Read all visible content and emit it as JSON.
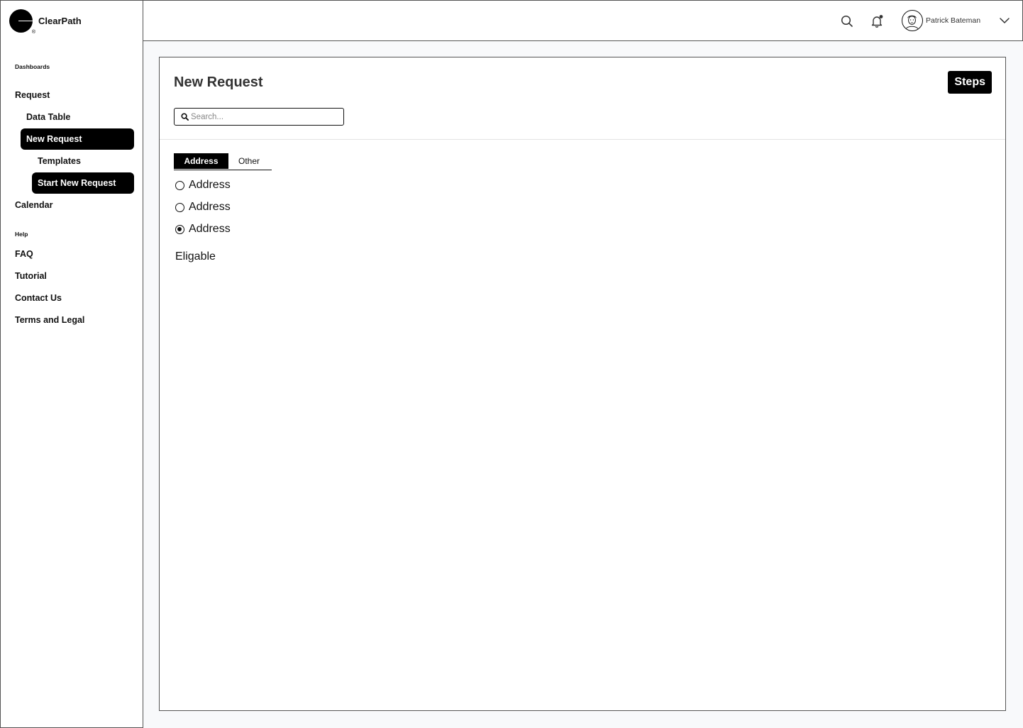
{
  "app": {
    "name": "ClearPath",
    "reg_mark": "®"
  },
  "header": {
    "user_name": "Patrick Bateman",
    "icons": [
      "search-icon",
      "bell-icon",
      "avatar",
      "chevron-down-icon"
    ]
  },
  "sidebar": {
    "section_dashboards": "Dashboards",
    "item_request": "Request",
    "item_data_table": "Data Table",
    "item_new_request": "New Request",
    "item_templates": "Templates",
    "item_start_new_request": "Start New Request",
    "item_calendar": "Calendar",
    "section_help": "Help",
    "item_faq": "FAQ",
    "item_tutorial": "Tutorial",
    "item_contact_us": "Contact Us",
    "item_terms": "Terms and Legal"
  },
  "main": {
    "title": "New Request",
    "steps_label": "Steps",
    "search_placeholder": "Search...",
    "tabs": [
      {
        "label": "Address",
        "active": true
      },
      {
        "label": "Other",
        "active": false
      }
    ],
    "options": [
      {
        "label": "Address",
        "checked": false
      },
      {
        "label": "Address",
        "checked": false
      },
      {
        "label": "Address",
        "checked": true
      }
    ],
    "status_text": "Eligable"
  },
  "colors": {
    "accent": "#000000",
    "background": "#f8f9fb",
    "panel": "#ffffff",
    "border": "#555555"
  }
}
